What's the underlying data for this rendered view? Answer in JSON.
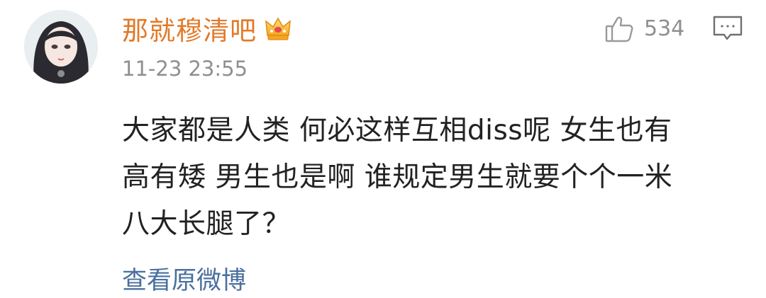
{
  "comment": {
    "username": "那就穆清吧",
    "timestamp": "11-23 23:55",
    "like_count": "534",
    "text_lines": [
      "大家都是人类 何必这样互相diss呢 女生也有",
      "高有矮 男生也是啊 谁规定男生就要个个一米",
      "八大长腿了？"
    ],
    "view_original_label": "查看原微博",
    "icons": {
      "avatar": "avatar",
      "badge": "crown-icon",
      "like": "thumbs-up-icon",
      "reply": "comment-icon"
    }
  },
  "colors": {
    "username": "#e07a2a",
    "link": "#4a6f9f",
    "meta": "#8f8f8f",
    "text": "#222222"
  }
}
